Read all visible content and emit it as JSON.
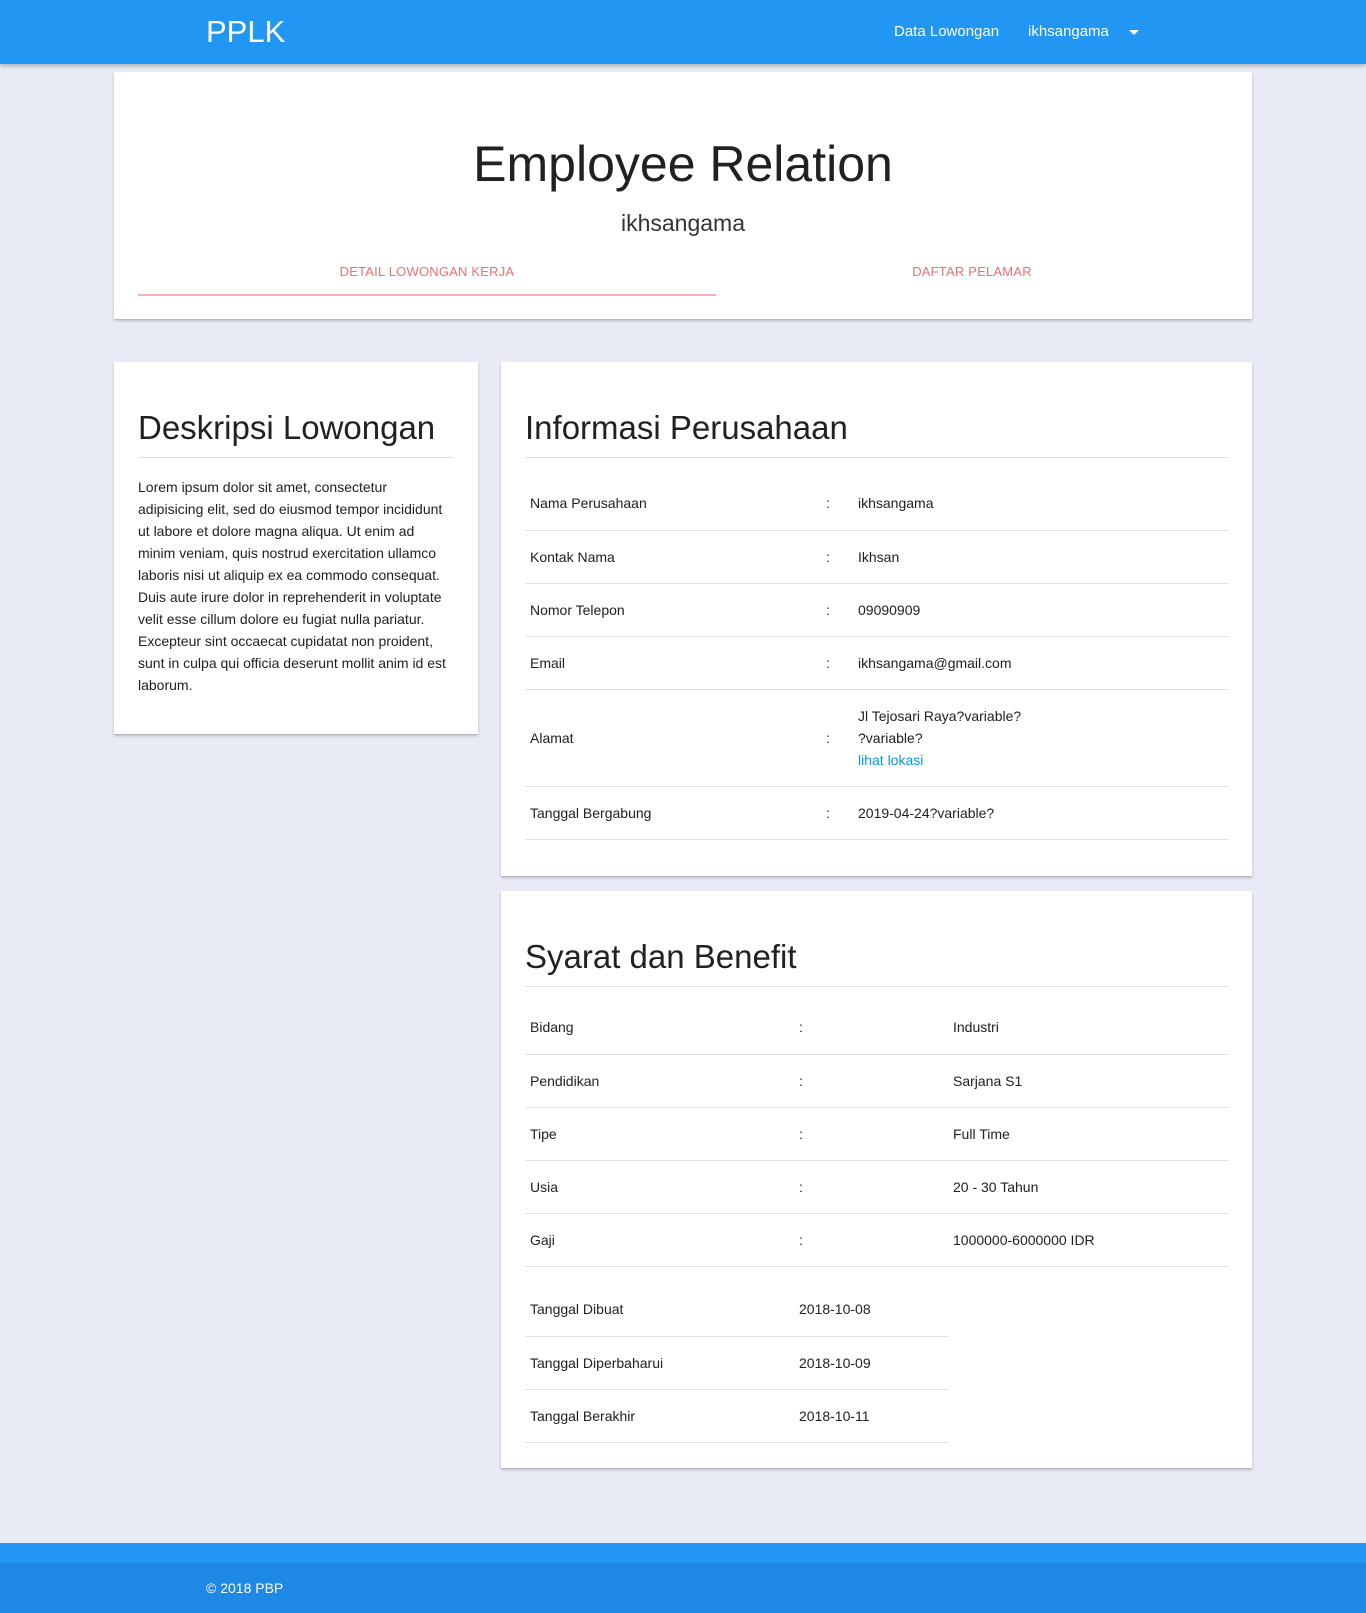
{
  "navbar": {
    "brand": "PPLK",
    "data_lowongan": "Data Lowongan",
    "user": "ikhsangama"
  },
  "header": {
    "title": "Employee Relation",
    "subtitle": "ikhsangama",
    "tabs": [
      {
        "label": "DETAIL LOWONGAN KERJA",
        "active": true
      },
      {
        "label": "DAFTAR PELAMAR",
        "active": false
      }
    ]
  },
  "deskripsi": {
    "title": "Deskripsi Lowongan",
    "text": "Lorem ipsum dolor sit amet, consectetur adipisicing elit, sed do eiusmod tempor incididunt ut labore et dolore magna aliqua. Ut enim ad minim veniam, quis nostrud exercitation ullamco laboris nisi ut aliquip ex ea commodo consequat. Duis aute irure dolor in reprehenderit in voluptate velit esse cillum dolore eu fugiat nulla pariatur. Excepteur sint occaecat cupidatat non proident, sunt in culpa qui officia deserunt mollit anim id est laborum."
  },
  "informasi": {
    "title": "Informasi Perusahaan",
    "rows": [
      {
        "label": "Nama Perusahaan",
        "sep": ":",
        "value": "ikhsangama"
      },
      {
        "label": "Kontak Nama",
        "sep": ":",
        "value": "Ikhsan"
      },
      {
        "label": "Nomor Telepon",
        "sep": ":",
        "value": "09090909"
      },
      {
        "label": "Email",
        "sep": ":",
        "value": "ikhsangama@gmail.com"
      },
      {
        "label": "Alamat",
        "sep": ":",
        "value_line1": "Jl Tejosari Raya?variable?",
        "value_line2": "?variable?",
        "link": "lihat lokasi"
      },
      {
        "label": "Tanggal Bergabung",
        "sep": ":",
        "value": "2019-04-24?variable?"
      }
    ]
  },
  "syarat": {
    "title": "Syarat dan Benefit",
    "rows": [
      {
        "label": "Bidang",
        "sep": ":",
        "value": "Industri"
      },
      {
        "label": "Pendidikan",
        "sep": ":",
        "value": "Sarjana S1"
      },
      {
        "label": "Tipe",
        "sep": ":",
        "value": "Full Time"
      },
      {
        "label": "Usia",
        "sep": ":",
        "value": "20 - 30 Tahun"
      },
      {
        "label": "Gaji",
        "sep": ":",
        "value": "1000000-6000000 IDR"
      }
    ],
    "dates": [
      {
        "label": "Tanggal Dibuat",
        "value": "2018-10-08"
      },
      {
        "label": "Tanggal Diperbaharui",
        "value": "2018-10-09"
      },
      {
        "label": "Tanggal Berakhir",
        "value": "2018-10-11"
      }
    ]
  },
  "footer": {
    "text": "© 2018 PBP"
  }
}
